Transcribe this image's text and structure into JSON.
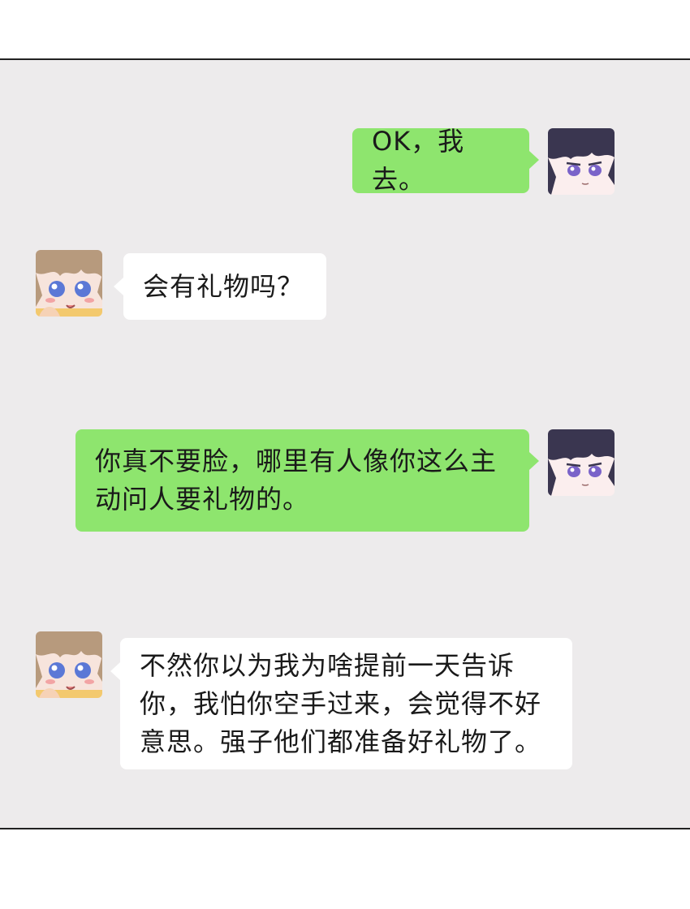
{
  "messages": [
    {
      "side": "right",
      "speaker": "dark-haired-boy",
      "text": "OK，我去。"
    },
    {
      "side": "left",
      "speaker": "light-haired-boy",
      "text": "会有礼物吗？"
    },
    {
      "side": "right",
      "speaker": "dark-haired-boy",
      "text": "你真不要脸，哪里有人像你这么主\n动问人要礼物的。"
    },
    {
      "side": "left",
      "speaker": "light-haired-boy",
      "text": "不然你以为我为啥提前一天告诉\n你，我怕你空手过来，会觉得不好\n意思。强子他们都准备好礼物了。"
    }
  ],
  "colors": {
    "chat_background": "#edebec",
    "outgoing_bubble": "#8ee56e",
    "incoming_bubble": "#ffffff",
    "frame_border": "#222222"
  },
  "icons": {
    "outgoing_avatar": "dark-haired-boy-avatar",
    "incoming_avatar": "light-haired-boy-avatar"
  }
}
